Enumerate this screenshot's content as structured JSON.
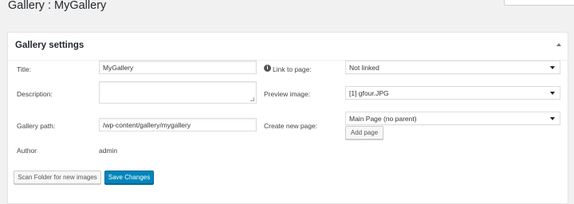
{
  "page": {
    "title": "Gallery : MyGallery"
  },
  "settings": {
    "box_title": "Gallery settings",
    "title_label": "Title:",
    "title_value": "MyGallery",
    "description_label": "Description:",
    "description_value": "",
    "path_label": "Gallery path:",
    "path_value": "/wp-content/gallery/mygallery",
    "author_label": "Author",
    "author_value": "admin",
    "link_label": "Link to page:",
    "link_value": "Not linked",
    "preview_label": "Preview image:",
    "preview_value": "[1] gfour.JPG",
    "create_label": "Create new page:",
    "create_value": "Main Page (no parent)",
    "add_page_label": "Add page"
  },
  "actions": {
    "scan_label": "Scan Folder for new images",
    "save_label": "Save Changes"
  },
  "colors": {
    "primary": "#0085ba",
    "background": "#f1f1f1"
  },
  "icons": {
    "info": "info-icon",
    "toggle": "collapse-arrow-icon",
    "dropdown": "chevron-down-icon"
  }
}
